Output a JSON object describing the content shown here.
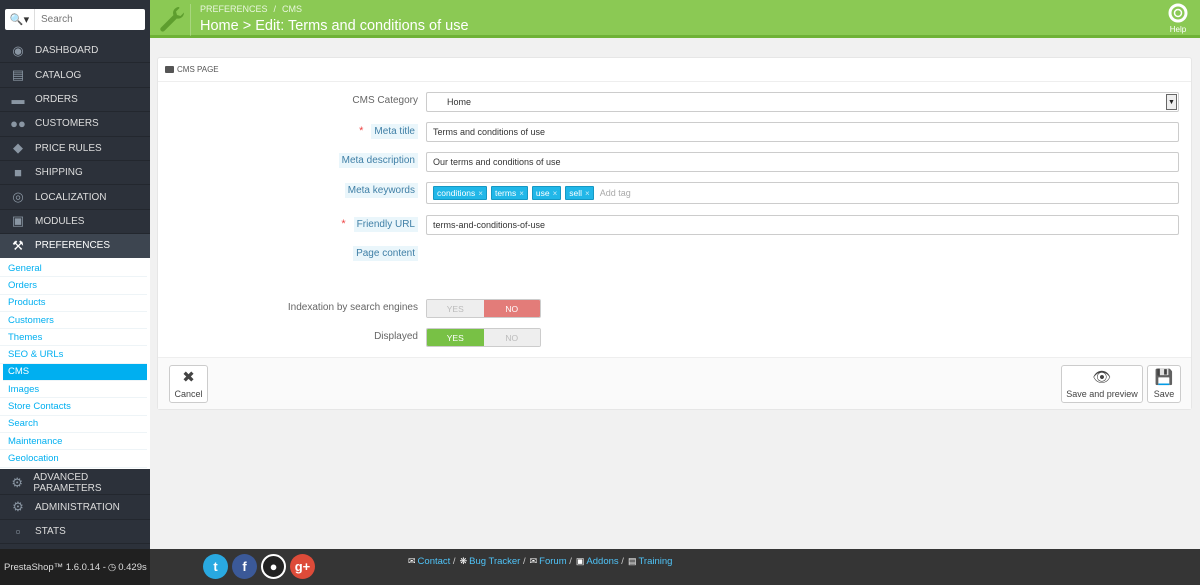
{
  "search": {
    "placeholder": "Search"
  },
  "nav_top": [
    {
      "label": "DASHBOARD",
      "icon": "dashboard-icon"
    },
    {
      "label": "CATALOG",
      "icon": "book-icon"
    },
    {
      "label": "ORDERS",
      "icon": "credit-card-icon"
    },
    {
      "label": "CUSTOMERS",
      "icon": "users-icon"
    },
    {
      "label": "PRICE RULES",
      "icon": "tags-icon"
    },
    {
      "label": "SHIPPING",
      "icon": "truck-icon"
    },
    {
      "label": "LOCALIZATION",
      "icon": "globe-icon"
    },
    {
      "label": "MODULES",
      "icon": "puzzle-icon"
    },
    {
      "label": "PREFERENCES",
      "icon": "wrench-icon"
    }
  ],
  "subnav": [
    "General",
    "Orders",
    "Products",
    "Customers",
    "Themes",
    "SEO & URLs",
    "CMS",
    "Images",
    "Store Contacts",
    "Search",
    "Maintenance",
    "Geolocation"
  ],
  "subnav_active": "CMS",
  "nav_bottom": [
    {
      "label": "ADVANCED PARAMETERS",
      "icon": "cogs-icon"
    },
    {
      "label": "ADMINISTRATION",
      "icon": "cog-icon"
    },
    {
      "label": "STATS",
      "icon": "bar-chart-icon"
    }
  ],
  "header": {
    "breadcrumb": [
      "PREFERENCES",
      "CMS"
    ],
    "title": "Home > Edit: Terms and conditions of use",
    "help": "Help",
    "accent": "#8bc954"
  },
  "panel": {
    "heading": "CMS PAGE",
    "category_label": "CMS Category",
    "category_value": "Home",
    "meta_title_label": "Meta title",
    "meta_title_value": "Terms and conditions of use",
    "meta_desc_label": "Meta description",
    "meta_desc_value": "Our terms and conditions of use",
    "meta_keywords_label": "Meta keywords",
    "tags": [
      "conditions",
      "terms",
      "use",
      "sell"
    ],
    "tag_placeholder": "Add tag",
    "friendly_url_label": "Friendly URL",
    "friendly_url_value": "terms-and-conditions-of-use",
    "page_content_label": "Page content",
    "indexation_label": "Indexation by search engines",
    "displayed_label": "Displayed",
    "yes": "YES",
    "no": "NO",
    "cancel": "Cancel",
    "save_preview": "Save and preview",
    "save": "Save"
  },
  "footer": {
    "version": "PrestaShop™ 1.6.0.14 - ",
    "time": "0.429s",
    "links": [
      "Contact",
      "Bug Tracker",
      "Forum",
      "Addons",
      "Training"
    ]
  }
}
